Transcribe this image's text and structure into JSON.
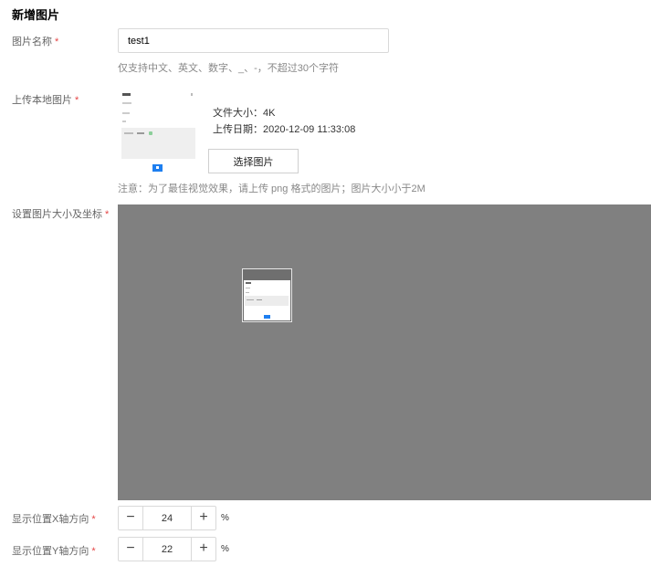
{
  "page": {
    "title": "新增图片"
  },
  "form": {
    "required_mark": "*",
    "name": {
      "label": "图片名称",
      "value": "test1",
      "hint": "仅支持中文、英文、数字、_、-，不超过30个字符"
    },
    "upload": {
      "label": "上传本地图片",
      "file_size": "文件大小：4K",
      "upload_date": "上传日期：2020-12-09 11:33:08",
      "choose_button": "选择图片",
      "note": "注意：为了最佳视觉效果，请上传 png 格式的图片；图片大小小于2M"
    },
    "position": {
      "label": "设置图片大小及坐标"
    },
    "x_axis": {
      "label": "显示位置X轴方向",
      "value": "24",
      "unit": "%",
      "minus": "−",
      "plus": "+"
    },
    "y_axis": {
      "label": "显示位置Y轴方向",
      "value": "22",
      "unit": "%",
      "minus": "−",
      "plus": "+"
    }
  },
  "colors": {
    "required": "#e54545",
    "canvas": "#808080",
    "accent": "#1e7ff0"
  }
}
